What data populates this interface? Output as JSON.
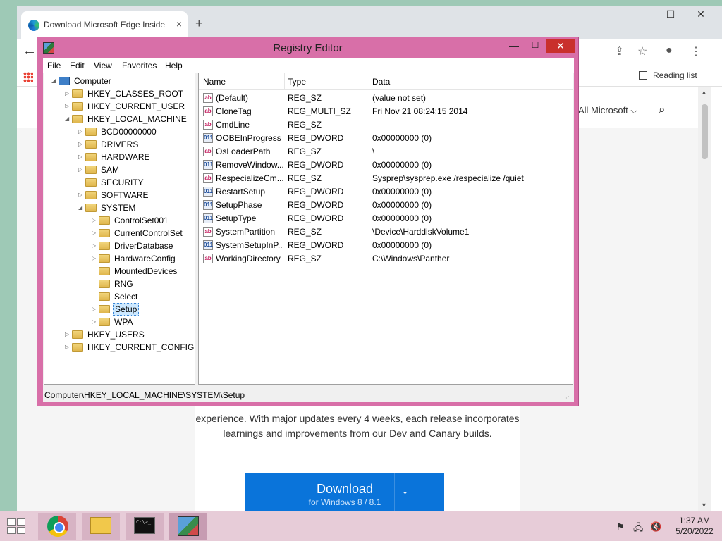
{
  "browser": {
    "tab_title": "Download Microsoft Edge Inside",
    "tab_close": "×",
    "new_tab": "+",
    "controls": {
      "minimize": "—",
      "maximize": "☐",
      "close": "✕"
    },
    "back": "←",
    "reading_list": "Reading list",
    "all_microsoft": "All Microsoft ⌵",
    "search_icon": "⌕",
    "page_blurb": "experience. With major updates every 4 weeks, each release incorporates learnings and improvements from our Dev and Canary builds.",
    "download_label": "Download",
    "download_sub": "for Windows 8 / 8.1",
    "download_caret": "⌄",
    "scroll_up": "▲",
    "scroll_down": "▼"
  },
  "regedit": {
    "title": "Registry Editor",
    "controls": {
      "minimize": "—",
      "maximize": "☐",
      "close": "✕"
    },
    "menu": [
      "File",
      "Edit",
      "View",
      "Favorites",
      "Help"
    ],
    "tree": [
      {
        "label": "Computer",
        "level": 0,
        "exp": "◢",
        "icon": "pc"
      },
      {
        "label": "HKEY_CLASSES_ROOT",
        "level": 1,
        "exp": "▷"
      },
      {
        "label": "HKEY_CURRENT_USER",
        "level": 1,
        "exp": "▷"
      },
      {
        "label": "HKEY_LOCAL_MACHINE",
        "level": 1,
        "exp": "◢"
      },
      {
        "label": "BCD00000000",
        "level": 2,
        "exp": "▷"
      },
      {
        "label": "DRIVERS",
        "level": 2,
        "exp": "▷"
      },
      {
        "label": "HARDWARE",
        "level": 2,
        "exp": "▷"
      },
      {
        "label": "SAM",
        "level": 2,
        "exp": "▷"
      },
      {
        "label": "SECURITY",
        "level": 2,
        "exp": ""
      },
      {
        "label": "SOFTWARE",
        "level": 2,
        "exp": "▷"
      },
      {
        "label": "SYSTEM",
        "level": 2,
        "exp": "◢"
      },
      {
        "label": "ControlSet001",
        "level": 3,
        "exp": "▷"
      },
      {
        "label": "CurrentControlSet",
        "level": 3,
        "exp": "▷"
      },
      {
        "label": "DriverDatabase",
        "level": 3,
        "exp": "▷"
      },
      {
        "label": "HardwareConfig",
        "level": 3,
        "exp": "▷"
      },
      {
        "label": "MountedDevices",
        "level": 3,
        "exp": ""
      },
      {
        "label": "RNG",
        "level": 3,
        "exp": ""
      },
      {
        "label": "Select",
        "level": 3,
        "exp": ""
      },
      {
        "label": "Setup",
        "level": 3,
        "exp": "▷",
        "selected": true
      },
      {
        "label": "WPA",
        "level": 3,
        "exp": "▷"
      },
      {
        "label": "HKEY_USERS",
        "level": 1,
        "exp": "▷"
      },
      {
        "label": "HKEY_CURRENT_CONFIG",
        "level": 1,
        "exp": "▷"
      }
    ],
    "columns": [
      "Name",
      "Type",
      "Data"
    ],
    "values": [
      {
        "name": "(Default)",
        "type": "REG_SZ",
        "data": "(value not set)"
      },
      {
        "name": "CloneTag",
        "type": "REG_MULTI_SZ",
        "data": "Fri Nov 21 08:24:15 2014"
      },
      {
        "name": "CmdLine",
        "type": "REG_SZ",
        "data": ""
      },
      {
        "name": "OOBEInProgress",
        "type": "REG_DWORD",
        "data": "0x00000000 (0)"
      },
      {
        "name": "OsLoaderPath",
        "type": "REG_SZ",
        "data": "\\"
      },
      {
        "name": "RemoveWindow...",
        "type": "REG_DWORD",
        "data": "0x00000000 (0)"
      },
      {
        "name": "RespecializeCm...",
        "type": "REG_SZ",
        "data": "Sysprep\\sysprep.exe /respecialize /quiet"
      },
      {
        "name": "RestartSetup",
        "type": "REG_DWORD",
        "data": "0x00000000 (0)"
      },
      {
        "name": "SetupPhase",
        "type": "REG_DWORD",
        "data": "0x00000000 (0)"
      },
      {
        "name": "SetupType",
        "type": "REG_DWORD",
        "data": "0x00000000 (0)"
      },
      {
        "name": "SystemPartition",
        "type": "REG_SZ",
        "data": "\\Device\\HarddiskVolume1"
      },
      {
        "name": "SystemSetupInP...",
        "type": "REG_DWORD",
        "data": "0x00000000 (0)"
      },
      {
        "name": "WorkingDirectory",
        "type": "REG_SZ",
        "data": "C:\\Windows\\Panther"
      }
    ],
    "status": "Computer\\HKEY_LOCAL_MACHINE\\SYSTEM\\Setup"
  },
  "taskbar": {
    "apps": [
      "chrome-icon",
      "file-explorer-icon",
      "command-prompt-icon",
      "registry-editor-icon"
    ],
    "active_app": "registry-editor-icon",
    "cmd_glyph": "C:\\>_",
    "tray": [
      "⚑",
      "🖧",
      "🔇"
    ],
    "time": "1:37 AM",
    "date": "5/20/2022"
  }
}
